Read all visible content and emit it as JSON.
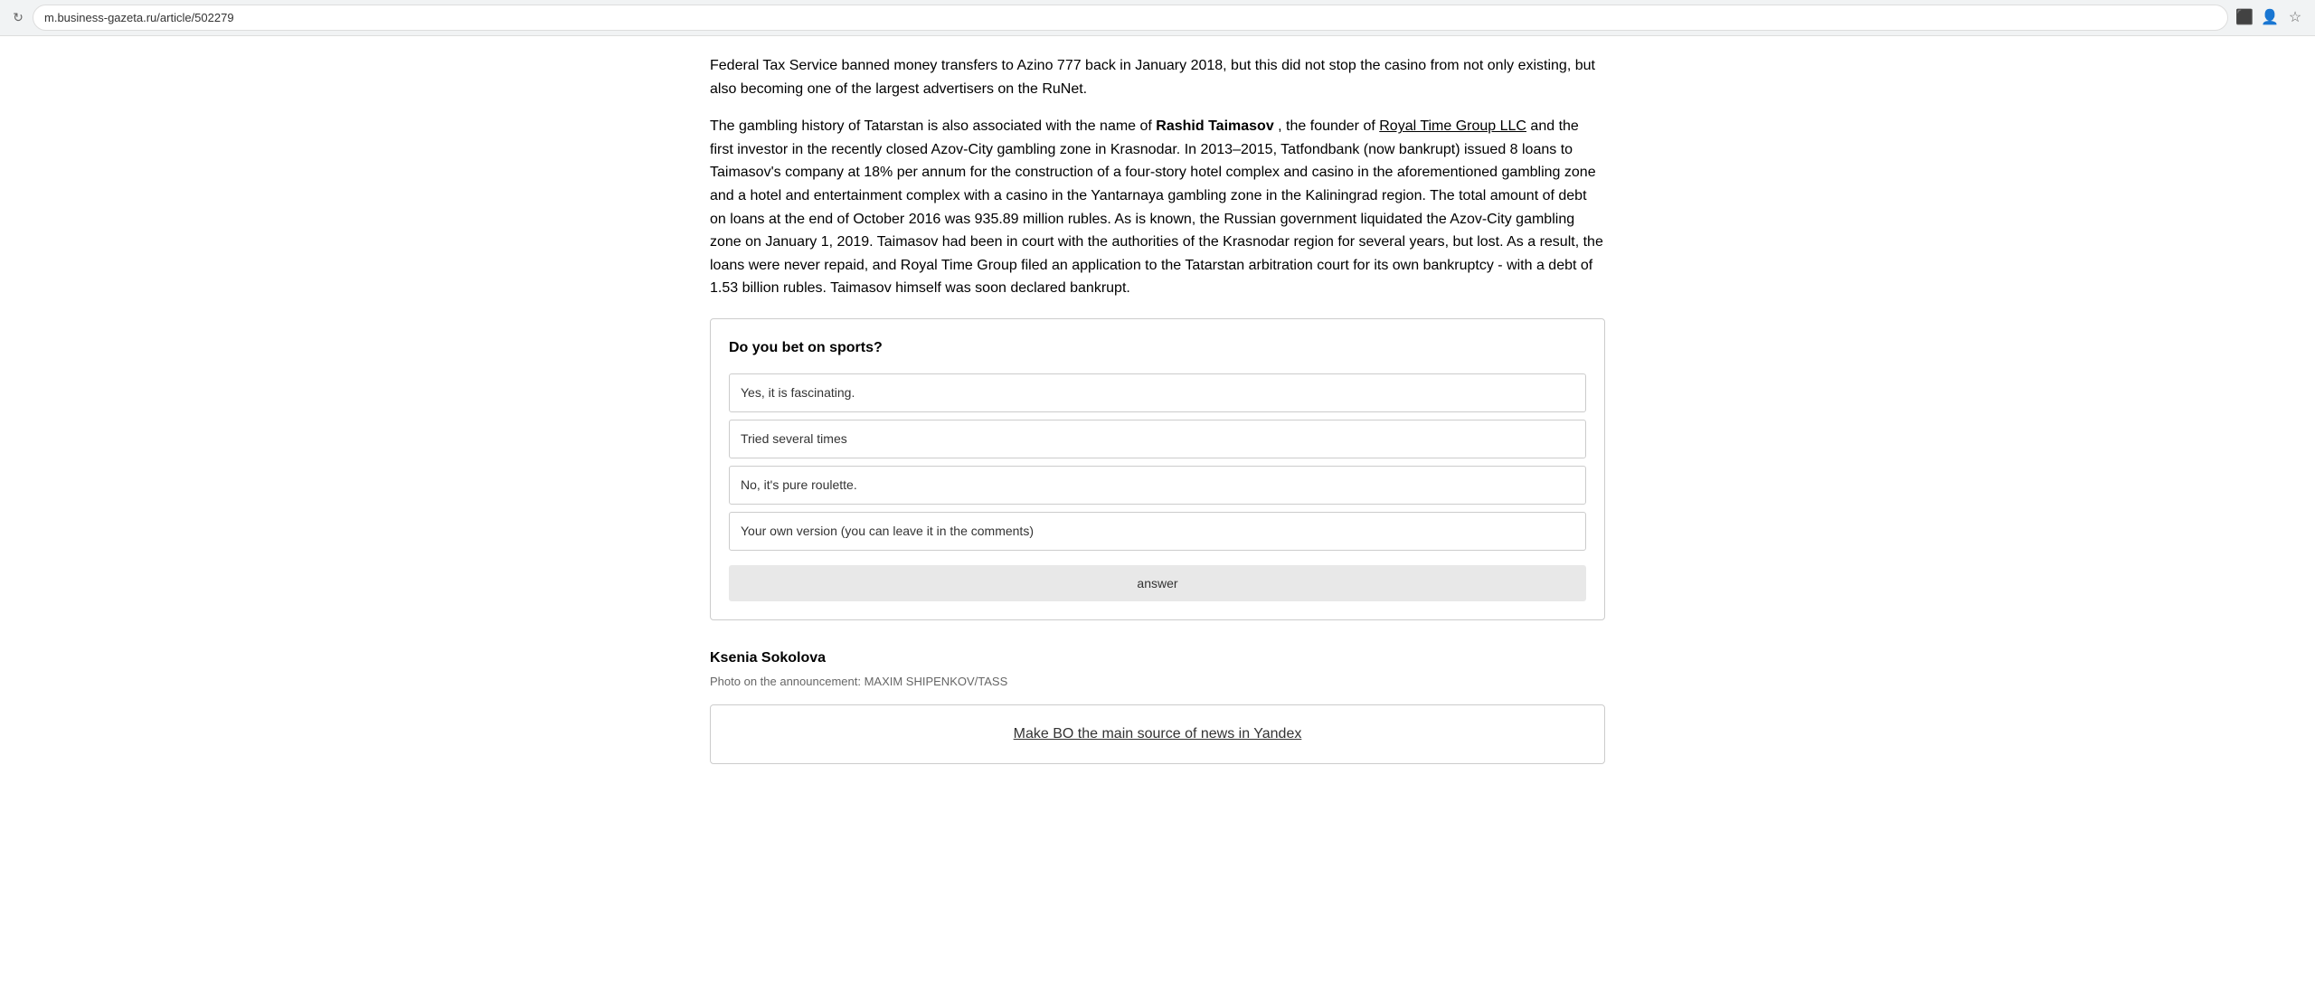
{
  "browser": {
    "url": "m.business-gazeta.ru/article/502279",
    "reload_icon": "↻",
    "security_icon": "🔒",
    "cast_icon": "⬛",
    "profile_icon": "👤",
    "star_icon": "☆"
  },
  "article": {
    "paragraph1": "Federal Tax Service banned money transfers to Azino 777 back in January 2018, but this did not stop the casino from not only existing, but also becoming one of the largest advertisers on the RuNet.",
    "paragraph2_before_bold": "The gambling history of Tatarstan is also associated with the name of ",
    "paragraph2_bold1": "Rashid Taimasov",
    "paragraph2_after_bold1": " , the founder of ",
    "paragraph2_link": "Royal Time Group LLC",
    "paragraph2_rest": "  and the first investor in the recently closed Azov-City gambling zone in Krasnodar. In 2013–2015, Tatfondbank (now bankrupt) issued 8 loans to Taimasov's company at 18% per annum for the construction of a four-story hotel complex and casino in the aforementioned gambling zone and a hotel and entertainment complex with a casino in the Yantarnaya gambling zone in the Kaliningrad region. The total amount of debt on loans at the end of October 2016 was 935.89 million rubles. As is known, the Russian government liquidated the Azov-City gambling zone on January 1, 2019. Taimasov had been in court with the authorities of the Krasnodar region for several years, but lost. As a result, the loans were never repaid, and Royal Time Group filed  an application to the Tatarstan arbitration court for its own bankruptcy - with a debt of 1.53 billion rubles. Taimasov himself was soon declared bankrupt."
  },
  "poll": {
    "question": "Do you bet on sports?",
    "options": [
      "Yes, it is fascinating.",
      "Tried several times",
      "No, it's pure roulette.",
      "Your own version (you can leave it in the comments)"
    ],
    "answer_button": "answer"
  },
  "author": {
    "name": "Ksenia Sokolova",
    "photo_credit": "Photo on the announcement: MAXIM SHIPENKOV/TASS"
  },
  "yandex_banner": {
    "link_text": "Make BO the main source of news in Yandex"
  }
}
